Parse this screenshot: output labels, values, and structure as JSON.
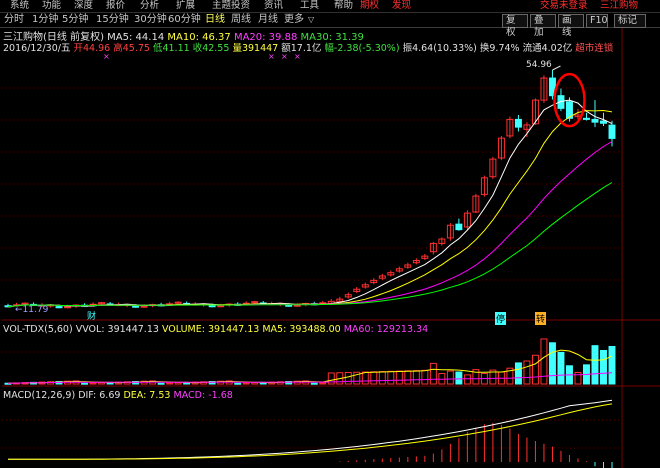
{
  "menu": {
    "items": [
      "系统",
      "功能",
      "深度",
      "报价",
      "分析",
      "扩展",
      "主题投资",
      "资讯",
      "工具",
      "帮助"
    ],
    "period_btn": "期权",
    "discover_btn": "发现",
    "right_a": "交易未登录",
    "right_b": "三江购物"
  },
  "periods": {
    "items": [
      "分时",
      "1分钟",
      "5分钟",
      "15分钟",
      "30分钟",
      "60分钟",
      "日线",
      "周线",
      "月线",
      "更多"
    ],
    "active": "日线",
    "more_caret": "▽",
    "right_buttons": [
      "复权",
      "叠加",
      "画线",
      "F10",
      "标记"
    ]
  },
  "stock": {
    "title": "三江购物(日线 前复权)",
    "ma5": "MA5: 44.14",
    "ma10": "MA10: 46.37",
    "ma20": "MA20: 39.88",
    "ma30": "MA30: 31.39",
    "date": "2016/12/30/五",
    "open": "开44.96",
    "high": "高45.75",
    "low": "低41.11",
    "close": "收42.55",
    "volume": "量391447",
    "amount": "额17.1亿",
    "change": "幅-2.38(-5.30%)",
    "amplitude": "振4.64(10.33%)",
    "turnover": "换9.74%",
    "float": "流通4.02亿",
    "tag": "超市连锁",
    "high_label": "54.96",
    "low_label": "11.79",
    "markers": [
      "财",
      "停",
      "转"
    ]
  },
  "vol_panel": {
    "name": "VOL-TDX(5,60)",
    "vvol": "VVOL: 391447.13",
    "volume": "VOLUME: 391447.13",
    "ma5": "MA5: 393488.00",
    "ma60": "MA60: 129213.34"
  },
  "macd_panel": {
    "name": "MACD(12,26,9)",
    "dif": "DIF: 6.69",
    "dea": "DEA: 7.53",
    "macd": "MACD: -1.68"
  },
  "colors": {
    "up": "#ff3030",
    "down": "#40ffff",
    "ma5": "#ffffff",
    "ma10": "#ffff00",
    "ma20": "#ff00ff",
    "ma30": "#00ff00",
    "highlight_circle": "#ff0000"
  },
  "chart_data": {
    "type": "candlestick",
    "price_candles": [
      {
        "o": 22.0,
        "h": 23.8,
        "l": 21.5,
        "c": 23.5
      },
      {
        "o": 23.5,
        "h": 24.6,
        "l": 23.1,
        "c": 24.3
      },
      {
        "o": 24.5,
        "h": 27.2,
        "l": 24.0,
        "c": 26.8
      },
      {
        "o": 27.0,
        "h": 28.0,
        "l": 25.8,
        "c": 26.0
      },
      {
        "o": 26.5,
        "h": 29.5,
        "l": 26.0,
        "c": 29.0
      },
      {
        "o": 29.2,
        "h": 32.5,
        "l": 29.0,
        "c": 32.1
      },
      {
        "o": 32.4,
        "h": 35.8,
        "l": 32.0,
        "c": 35.4
      },
      {
        "o": 35.6,
        "h": 39.2,
        "l": 35.2,
        "c": 38.8
      },
      {
        "o": 39.0,
        "h": 43.0,
        "l": 38.6,
        "c": 42.6
      },
      {
        "o": 43.0,
        "h": 46.5,
        "l": 42.6,
        "c": 46.0
      },
      {
        "o": 46.0,
        "h": 46.8,
        "l": 43.8,
        "c": 44.6
      },
      {
        "o": 44.2,
        "h": 45.5,
        "l": 42.8,
        "c": 45.0
      },
      {
        "o": 45.2,
        "h": 49.8,
        "l": 45.0,
        "c": 49.5
      },
      {
        "o": 49.5,
        "h": 54.0,
        "l": 49.0,
        "c": 53.5
      },
      {
        "o": 53.5,
        "h": 54.96,
        "l": 49.6,
        "c": 50.3
      },
      {
        "o": 50.3,
        "h": 51.6,
        "l": 47.5,
        "c": 48.0
      },
      {
        "o": 49.2,
        "h": 50.0,
        "l": 45.6,
        "c": 46.2
      },
      {
        "o": 46.5,
        "h": 47.9,
        "l": 46.0,
        "c": 46.8
      },
      {
        "o": 46.2,
        "h": 47.2,
        "l": 45.8,
        "c": 46.0
      },
      {
        "o": 46.0,
        "h": 49.5,
        "l": 44.6,
        "c": 45.5
      },
      {
        "o": 45.7,
        "h": 47.2,
        "l": 44.8,
        "c": 45.3
      },
      {
        "o": 44.96,
        "h": 45.75,
        "l": 41.11,
        "c": 42.55
      }
    ],
    "volumes": [
      215000,
      110000,
      135000,
      125000,
      95000,
      150000,
      110000,
      145000,
      125000,
      165000,
      220000,
      240000,
      300000,
      470000,
      430000,
      330000,
      190000,
      120000,
      200000,
      400000,
      350000,
      391447
    ],
    "macd_bars": [
      1.2,
      1.8,
      2.6,
      3.4,
      4.3,
      4.9,
      5.4,
      5.6,
      5.3,
      4.8,
      4.0,
      3.5,
      3.0,
      2.6,
      2.2,
      1.6,
      1.0,
      0.5,
      0.1,
      -0.6,
      -1.1,
      -1.68
    ]
  }
}
